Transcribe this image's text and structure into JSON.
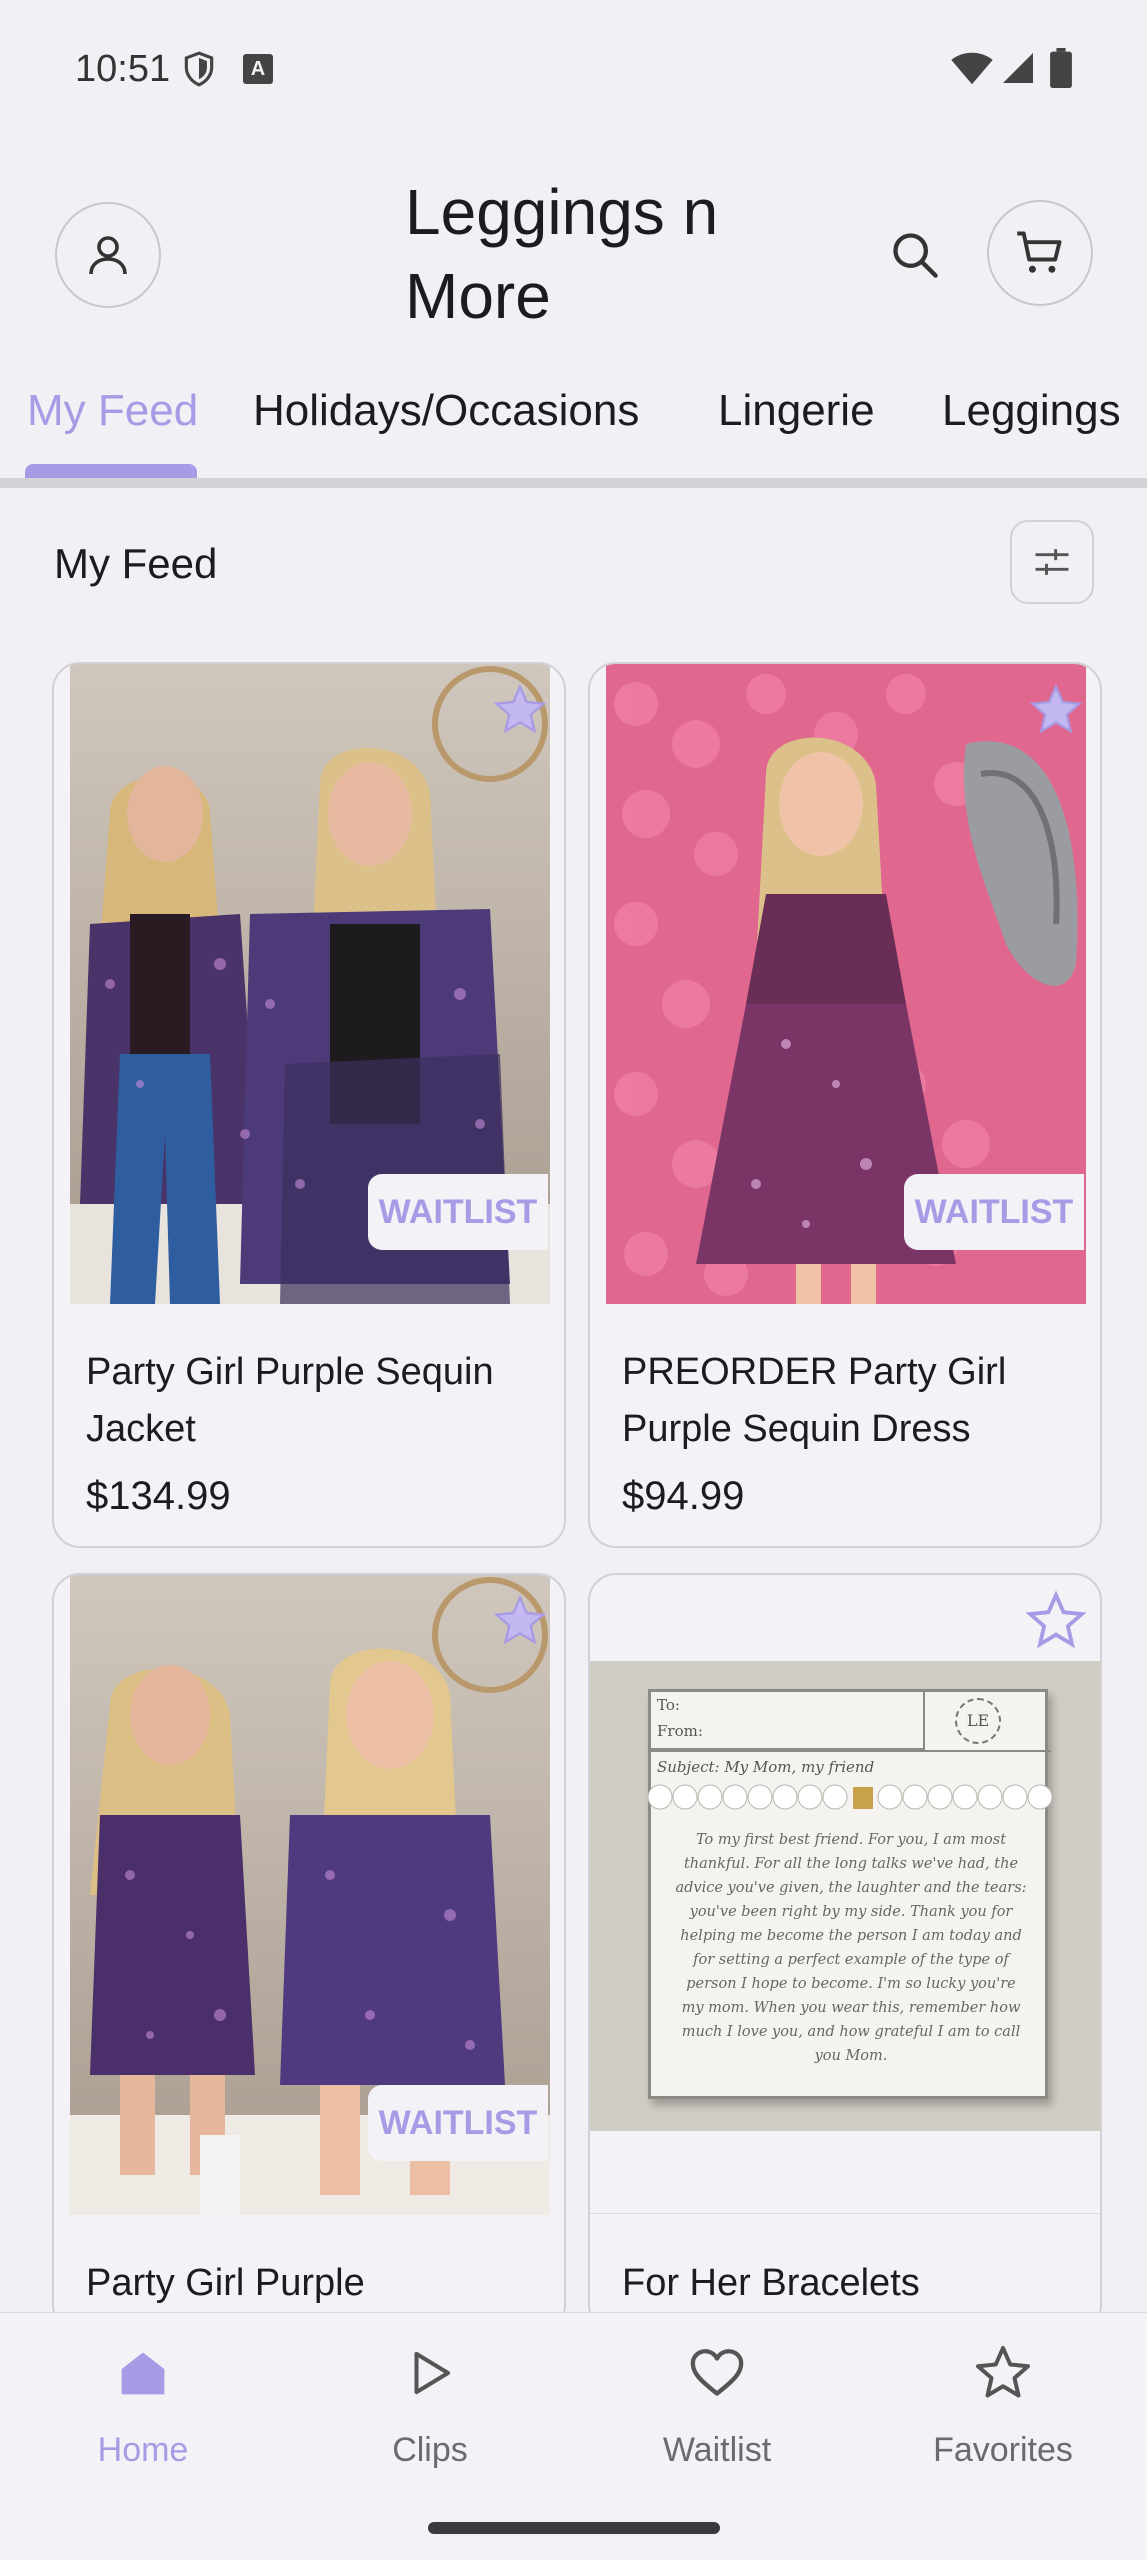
{
  "status_bar": {
    "time": "10:51"
  },
  "header": {
    "store_title": "Leggings n More"
  },
  "tabs": [
    {
      "label": "My Feed",
      "active": true
    },
    {
      "label": "Holidays/Occasions",
      "active": false
    },
    {
      "label": "Lingerie",
      "active": false
    },
    {
      "label": "Leggings",
      "active": false
    }
  ],
  "feed": {
    "title": "My Feed"
  },
  "products": [
    {
      "name": "Party Girl Purple Sequin Jacket",
      "price": "$134.99",
      "badge": "WAITLIST"
    },
    {
      "name": "PREORDER Party Girl Purple Sequin Dress",
      "price": "$94.99",
      "badge": "WAITLIST"
    },
    {
      "name": "Party Girl Purple",
      "price": "",
      "badge": "WAITLIST"
    },
    {
      "name": "For Her Bracelets",
      "price": "",
      "badge": ""
    }
  ],
  "bracelet_card_text": {
    "to": "To:",
    "from": "From:",
    "subject": "Subject: My Mom, my friend",
    "message": "To my first best friend. For you, I am most thankful. For all the long talks we've had, the advice you've given, the laughter and the tears: you've been right by my side. Thank you for helping me become the person I am today and for setting a perfect example of the type of person I hope to become. I'm so lucky you're my mom. When you wear this, remember how much I love you, and how grateful I am to call you Mom."
  },
  "bottom_nav": [
    {
      "label": "Home",
      "icon": "home-icon",
      "active": true
    },
    {
      "label": "Clips",
      "icon": "play-icon",
      "active": false
    },
    {
      "label": "Waitlist",
      "icon": "heart-icon",
      "active": false
    },
    {
      "label": "Favorites",
      "icon": "star-icon",
      "active": false
    }
  ],
  "colors": {
    "accent": "#a99ae6",
    "background": "#f1f0f4",
    "text": "#1c1b1f"
  }
}
